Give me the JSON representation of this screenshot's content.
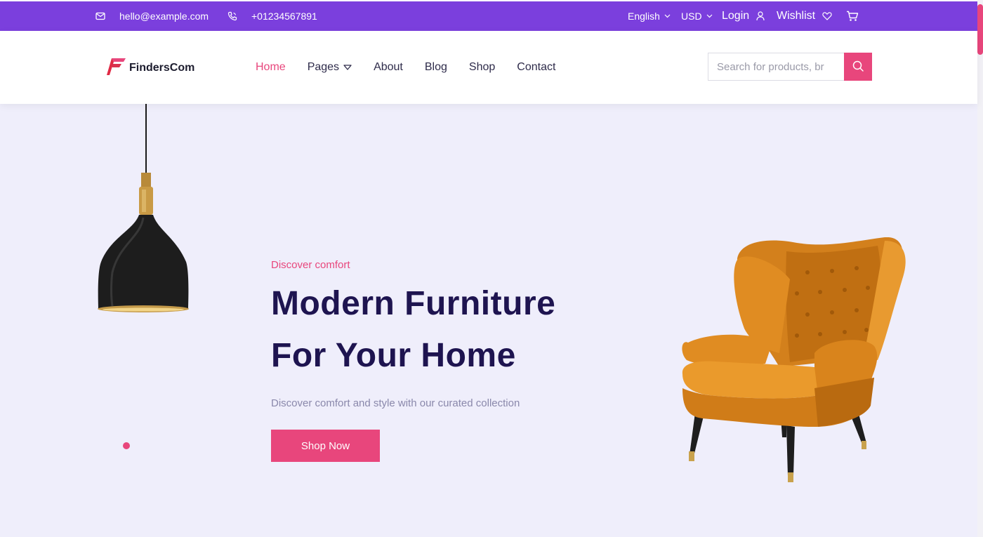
{
  "topbar": {
    "email": "hello@example.com",
    "phone": "+01234567891",
    "language": "English",
    "currency": "USD",
    "login_label": "Login",
    "wishlist_label": "Wishlist"
  },
  "header": {
    "logo_text": "FindersCom",
    "nav": [
      {
        "label": "Home",
        "active": true
      },
      {
        "label": "Pages"
      },
      {
        "label": "About"
      },
      {
        "label": "Blog"
      },
      {
        "label": "Shop"
      },
      {
        "label": "Contact"
      }
    ],
    "search_placeholder": "Search for products, br"
  },
  "hero": {
    "eyebrow": "Discover comfort",
    "headline_line1": "Modern Furniture",
    "headline_line2": "For Your Home",
    "subtext": "Discover comfort and style with our curated collection",
    "cta_label": "Shop Now"
  },
  "colors": {
    "topbar_bg": "#7b3fdd",
    "accent": "#e8467c",
    "heading": "#1e1450",
    "hero_bg": "#efeefb"
  },
  "icons": [
    "mail-icon",
    "phone-icon",
    "chevron-down-icon",
    "user-icon",
    "heart-icon",
    "cart-icon",
    "search-icon"
  ]
}
